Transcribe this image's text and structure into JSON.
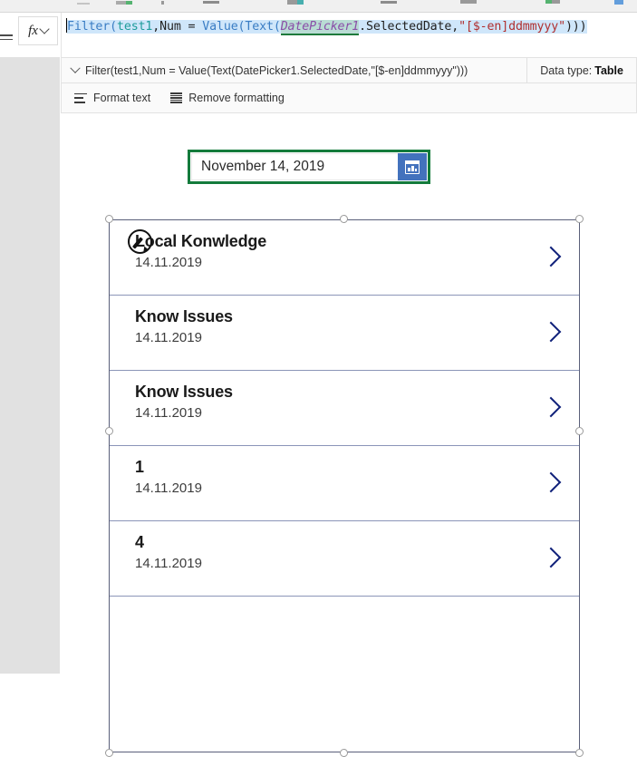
{
  "colors": {
    "accent_blue": "#4372bd",
    "selection_green": "#147b3c",
    "chevron_navy": "#10217a",
    "row_divider": "#8b95b8",
    "formula_selection": "#cfe6fa",
    "panel_gray": "#e1e1e1"
  },
  "formula_bar": {
    "fx_label": "fx",
    "fx_icon": "function-icon",
    "dropdown_icon": "chevron-down-icon",
    "equals_icon": "equals-icon",
    "value": "Filter(test1,Num = Value(Text(DatePicker1.SelectedDate,\"[$-en]ddmmyyy\")))",
    "tokens": [
      {
        "text": "Filter(",
        "kind": "fn"
      },
      {
        "text": "test1",
        "kind": "tbl"
      },
      {
        "text": ",Num = ",
        "kind": "plain"
      },
      {
        "text": "Value(",
        "kind": "fn"
      },
      {
        "text": "Text(",
        "kind": "fn"
      },
      {
        "text": "DatePicker1",
        "kind": "ctl"
      },
      {
        "text": ".SelectedDate,",
        "kind": "plain"
      },
      {
        "text": "\"[$-en]ddmmyyy\"",
        "kind": "str"
      },
      {
        "text": ")))",
        "kind": "plain"
      }
    ]
  },
  "intellisense": {
    "expand_icon": "chevron-down-icon",
    "formula_preview": "Filter(test1,Num = Value(Text(DatePicker1.SelectedDate,\"[$-en]ddmmyyy\")))",
    "data_type_label": "Data type:",
    "data_type_value": "Table"
  },
  "format_toolbar": {
    "buttons": [
      {
        "label": "Format text",
        "icon": "format-text-icon"
      },
      {
        "label": "Remove formatting",
        "icon": "remove-formatting-icon"
      }
    ]
  },
  "date_picker": {
    "value": "November 14, 2019",
    "calendar_icon": "calendar-icon",
    "selected": true
  },
  "gallery": {
    "selected": true,
    "rows": [
      {
        "title": "Local Konwledge",
        "date": "14.11.2019",
        "chevron_icon": "chevron-right-icon",
        "has_edit_icon": true
      },
      {
        "title": "Know Issues",
        "date": "14.11.2019",
        "chevron_icon": "chevron-right-icon",
        "has_edit_icon": false
      },
      {
        "title": "Know Issues",
        "date": "14.11.2019",
        "chevron_icon": "chevron-right-icon",
        "has_edit_icon": false
      },
      {
        "title": "1",
        "date": "14.11.2019",
        "chevron_icon": "chevron-right-icon",
        "has_edit_icon": false
      },
      {
        "title": "4",
        "date": "14.11.2019",
        "chevron_icon": "chevron-right-icon",
        "has_edit_icon": false
      },
      {
        "title": "",
        "date": "",
        "chevron_icon": "",
        "has_edit_icon": false
      }
    ],
    "edit_icon": "edit-pencil-icon"
  }
}
